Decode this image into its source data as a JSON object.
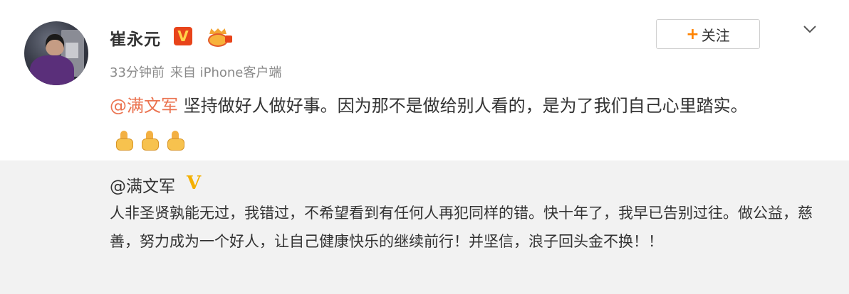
{
  "post": {
    "author_name": "崔永元",
    "verified_badge": "V",
    "member_icon": "weibo-member-icon",
    "time": "33分钟前",
    "source": "来自 iPhone客户端",
    "follow_button": {
      "plus": "+",
      "label": "关注"
    },
    "more_icon": "chevron-down-icon",
    "mention": "@满文军",
    "text": " 坚持做好人做好事。因为那不是做给别人看的，是为了我们自己心里踏实。",
    "emojis": [
      "thumbs-up-icon",
      "thumbs-up-icon",
      "thumbs-up-icon"
    ]
  },
  "repost": {
    "author": "@满文军",
    "verified_badge": "V",
    "text": "人非圣贤孰能无过，我错过，不希望看到有任何人再犯同样的错。快十年了，我早已告别过往。做公益，慈善，努力成为一个好人，让自己健康快乐的继续前行！并坚信，浪子回头金不换！！"
  },
  "colors": {
    "mention": "#eb7350",
    "follow_plus": "#ff8200",
    "badge_red": "#e8441a",
    "badge_gold": "#f4b000",
    "repost_bg": "#f2f2f2",
    "meta_gray": "#8a8a8a"
  }
}
